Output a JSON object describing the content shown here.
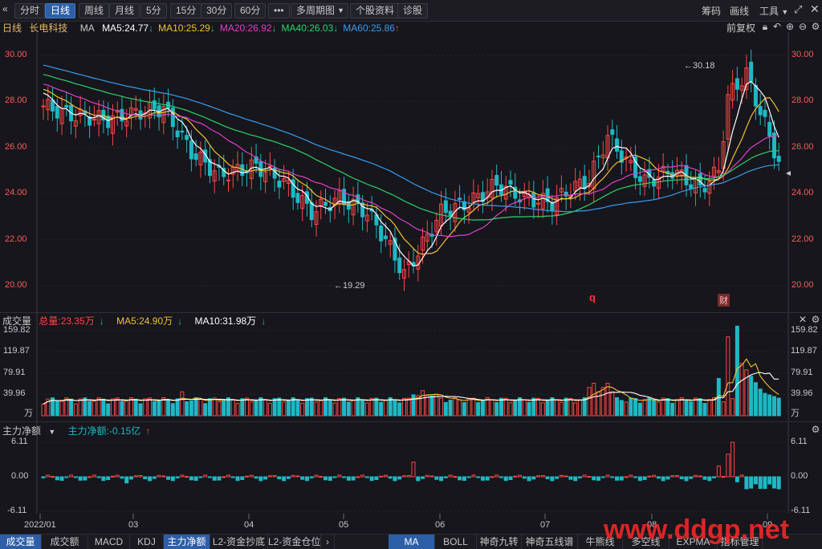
{
  "toolbar": {
    "back_icon": "double-chevron-left-icon",
    "periods": [
      "分时",
      "日线",
      "周线",
      "月线",
      "5分",
      "15分",
      "30分",
      "60分"
    ],
    "active_period": "日线",
    "more_label": "•••",
    "multi_period_label": "多周期图",
    "stock_info_label": "个股资料",
    "diagnose_label": "诊股",
    "chips_label": "筹码",
    "draw_label": "画线",
    "tools_label": "工具",
    "expand_icon": "expand-icon",
    "close_icon": "close-icon"
  },
  "main_pane": {
    "period_label": "日线",
    "stock_name": "长电科技",
    "indicator": "MA",
    "ma": [
      {
        "label": "MA5:24.77",
        "arrow": "↓",
        "color": "#ffffff",
        "dir": "dn"
      },
      {
        "label": "MA10:25.29",
        "arrow": "↓",
        "color": "#f2c230",
        "dir": "dn"
      },
      {
        "label": "MA20:26.92",
        "arrow": "↓",
        "color": "#e040c8",
        "dir": "dn"
      },
      {
        "label": "MA40:26.03",
        "arrow": "↓",
        "color": "#2fd36a",
        "dir": "dn"
      },
      {
        "label": "MA60:25.86",
        "arrow": "↑",
        "color": "#3a9cf0",
        "dir": "up"
      }
    ],
    "adjust_label": "前复权",
    "y_ticks": [
      "30.00",
      "28.00",
      "26.00",
      "24.00",
      "22.00",
      "20.00"
    ],
    "high_label": "30.18",
    "low_label": "19.29",
    "marker_q": "q",
    "marker_cai": "财"
  },
  "volume_pane": {
    "title": "成交量",
    "total_label": "总量:23.35万",
    "total_arrow": "↓",
    "ma5_label": "MA5:24.90万",
    "ma5_arrow": "↓",
    "ma10_label": "MA10:31.98万",
    "ma10_arrow": "↓",
    "y_ticks": [
      "159.82",
      "119.87",
      "79.91",
      "39.96"
    ],
    "unit": "万"
  },
  "flow_pane": {
    "title": "主力净额",
    "value_label": "主力净额:-0.15亿",
    "value_arrow": "↑",
    "y_ticks": [
      "6.11",
      "0.00",
      "-6.11"
    ]
  },
  "x_axis": [
    "2022/01",
    "03",
    "04",
    "05",
    "06",
    "07",
    "08",
    "09"
  ],
  "bottom_tabs_left": [
    "成交量",
    "成交额",
    "MACD",
    "KDJ",
    "主力净额",
    "L2-资金抄底",
    "L2-资金仓位"
  ],
  "bottom_tabs_right": [
    "MA",
    "BOLL",
    "神奇九转",
    "神奇五线谱",
    "牛熊线",
    "多空线",
    "EXPMA",
    "指标管理"
  ],
  "active_left_tab": "成交量",
  "active_left_tab2": "主力净额",
  "active_right_tab": "MA",
  "watermark": "www.ddgp.net",
  "colors": {
    "up": "#ff4545",
    "down": "#1fb8c4",
    "ma5": "#ffffff",
    "ma10": "#f2c230",
    "ma20": "#e040c8",
    "ma40": "#2fd36a",
    "ma60": "#3a9cf0"
  },
  "chart_data": {
    "type": "line",
    "title": "长电科技 日线",
    "x": [
      "2022/01",
      "03",
      "04",
      "05",
      "06",
      "07",
      "08",
      "09"
    ],
    "ylim": [
      19,
      31
    ],
    "series": [
      {
        "name": "MA5",
        "last": 24.77
      },
      {
        "name": "MA10",
        "last": 25.29
      },
      {
        "name": "MA20",
        "last": 26.92
      },
      {
        "name": "MA40",
        "last": 26.03
      },
      {
        "name": "MA60",
        "last": 25.86
      }
    ],
    "annotations": [
      {
        "text": "30.18",
        "value": 30.18
      },
      {
        "text": "19.29",
        "value": 19.29
      }
    ]
  }
}
